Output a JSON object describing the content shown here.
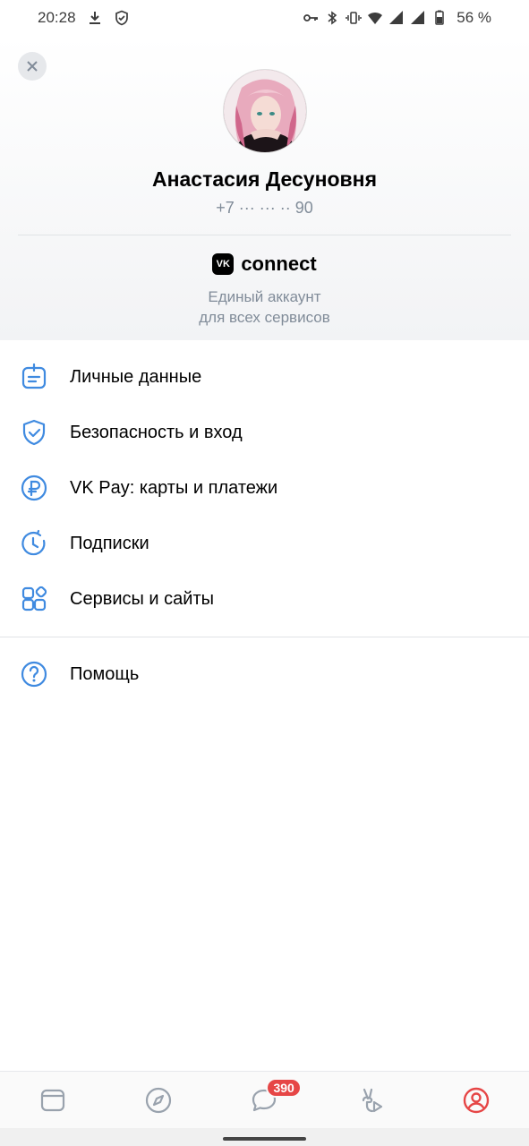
{
  "status_bar": {
    "time": "20:28",
    "battery": "56 %",
    "icons": [
      "download-icon",
      "shield-check-icon",
      "key-icon",
      "bluetooth-icon",
      "vibrate-icon",
      "wifi-icon",
      "signal-icon",
      "signal-icon",
      "battery-icon"
    ]
  },
  "profile": {
    "name": "Анастасия Десуновня",
    "phone": "+7 ··· ··· ·· 90"
  },
  "connect": {
    "logo_badge": "VK",
    "logo_word": "connect",
    "subtitle_line1": "Единый аккаунт",
    "subtitle_line2": "для всех сервисов"
  },
  "menu": {
    "items": [
      {
        "label": "Личные данные",
        "icon": "personal-data-icon"
      },
      {
        "label": "Безопасность и вход",
        "icon": "shield-icon"
      },
      {
        "label": "VK Pay: карты и платежи",
        "icon": "ruble-icon"
      },
      {
        "label": "Подписки",
        "icon": "subscription-clock-icon"
      },
      {
        "label": "Сервисы и сайты",
        "icon": "services-grid-icon"
      }
    ],
    "help": {
      "label": "Помощь",
      "icon": "help-icon"
    }
  },
  "bottom_nav": {
    "items": [
      "feed-icon",
      "discover-icon",
      "messages-icon",
      "clips-icon",
      "profile-icon"
    ],
    "messages_badge": "390",
    "active": "profile-icon"
  },
  "colors": {
    "accent": "#3f8ae0",
    "badge": "#e64646",
    "active_nav": "#e64646",
    "secondary_text": "#818c99"
  }
}
